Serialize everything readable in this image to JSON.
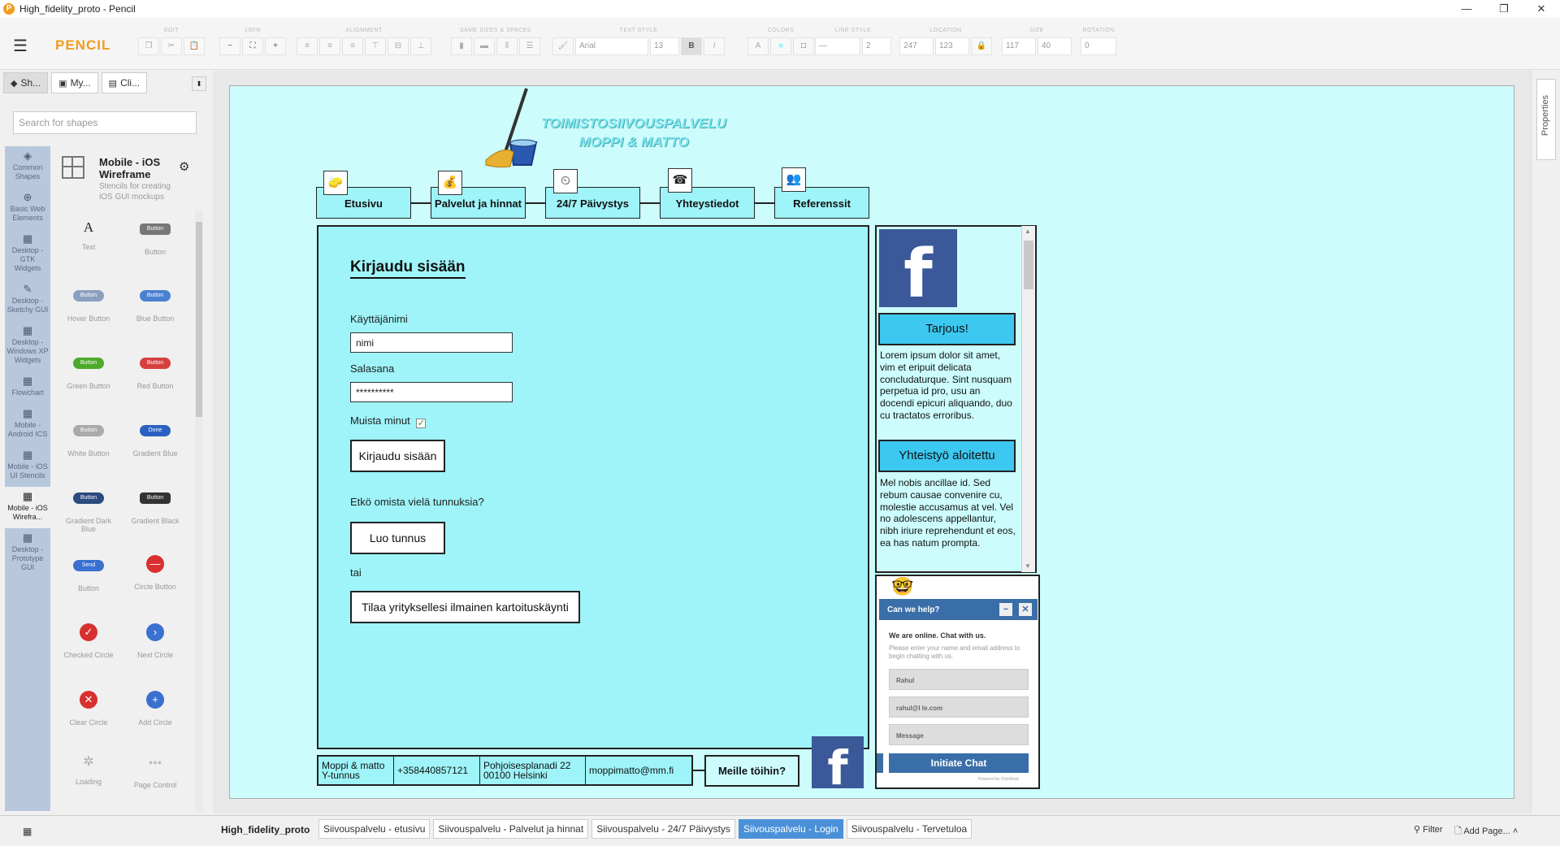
{
  "window": {
    "title": "High_fidelity_proto - Pencil",
    "controls": [
      "—",
      "❐",
      "✕"
    ]
  },
  "toolbar": {
    "brand": "PENCIL",
    "groups": {
      "edit": "EDIT",
      "zoom": "100%",
      "alignment": "ALIGNMENT",
      "same_sizes": "SAME SIZES & SPACES",
      "text_style": "TEXT STYLE",
      "colors": "COLORS",
      "line_style": "LINE STYLE",
      "location": "LOCATION",
      "size": "SIZE",
      "rotation": "ROTATION"
    },
    "font_name": "Arial",
    "font_size": "13",
    "bold": "B",
    "italic": "I",
    "line_width": "2",
    "loc_x": "247",
    "loc_y": "123",
    "size_w": "117",
    "size_h": "40",
    "rotation": "0"
  },
  "left": {
    "tabs": [
      {
        "icon": "stack-icon",
        "label": "Sh..."
      },
      {
        "icon": "briefcase-icon",
        "label": "My..."
      },
      {
        "icon": "image-icon",
        "label": "Cli..."
      }
    ],
    "search_placeholder": "Search for shapes",
    "categories": [
      "Common Shapes",
      "Basic Web Elements",
      "Desktop - GTK Widgets",
      "Desktop - Sketchy GUI",
      "Desktop - Windows XP Widgets",
      "Flowchart",
      "Mobile - Android ICS",
      "Mobile - iOS UI Stencils",
      "Mobile - iOS Wirefra...",
      "Desktop - Prototype GUI"
    ],
    "library": {
      "name": "Mobile - iOS Wireframe",
      "desc": "Stencils for creating iOS GUI mockups"
    },
    "shapes": [
      {
        "label": "Text",
        "preview": "A"
      },
      {
        "label": "Button",
        "preview": "Button"
      },
      {
        "label": "Hover Button",
        "preview": "Button"
      },
      {
        "label": "Blue Button",
        "preview": "Button"
      },
      {
        "label": "Green Button",
        "preview": "Button"
      },
      {
        "label": "Red Button",
        "preview": "Button"
      },
      {
        "label": "White Button",
        "preview": "Button"
      },
      {
        "label": "Gradient Blue",
        "preview": "Done"
      },
      {
        "label": "Gradient Dark Blue",
        "preview": "Button"
      },
      {
        "label": "Gradient Black",
        "preview": "Button"
      },
      {
        "label": "Button",
        "preview": "Send"
      },
      {
        "label": "Circle Button",
        "preview": "—"
      },
      {
        "label": "Checked Circle",
        "preview": "✓"
      },
      {
        "label": "Next Circle",
        "preview": "›"
      },
      {
        "label": "Clear Circle",
        "preview": "✕"
      },
      {
        "label": "Add Circle",
        "preview": "+"
      },
      {
        "label": "Loading",
        "preview": "✲"
      },
      {
        "label": "Page Control",
        "preview": "●●●"
      }
    ]
  },
  "right": {
    "properties": "Properties"
  },
  "mockup": {
    "logo_line1": "TOIMISTOSIIVOUSPALVELU",
    "logo_line2": "MOPPI & MATTO",
    "nav": [
      "Etusivu",
      "Palvelut ja hinnat",
      "24/7 Päivystys",
      "Yhteystiedot",
      "Referenssit"
    ],
    "login": {
      "heading": "Kirjaudu sisään",
      "user_label": "Käyttäjänimi",
      "user_value": "nimi",
      "pass_label": "Salasana",
      "pass_value": "**********",
      "remember": "Muista minut",
      "remember_check": "✓",
      "login_button": "Kirjaudu sisään",
      "no_account": "Etkö omista vielä tunnuksia?",
      "create_button": "Luo tunnus",
      "or": "tai",
      "visit_button": "Tilaa yrityksellesi ilmainen kartoituskäynti"
    },
    "side": {
      "fb": "f",
      "offer_button": "Tarjous!",
      "offer_text": "Lorem ipsum dolor sit amet, vim et eripuit delicata concludaturque. Sint nusquam perpetua id pro, usu an docendi epicuri aliquando, duo cu tractatos erroribus.",
      "coop_button": "Yhteistyö aloitettu",
      "coop_text": "Mel nobis ancillae id. Sed rebum causae convenire cu, molestie accusamus at vel. Vel no adolescens appellantur, nibh iriure reprehendunt et eos, ea has natum prompta."
    },
    "chat": {
      "title": "Can we help?",
      "online": "We are online. Chat with us.",
      "desc": "Please enter your name and email address to begin chatting with us.",
      "name_value": "Rahul",
      "email_value": "rahul@l          le.com",
      "message_value": "Message",
      "button": "Initiate Chat",
      "powered": "Powered by ClickDesk"
    },
    "footer": {
      "company_line1": "Moppi & matto",
      "company_line2": "Y-tunnus",
      "phone": "+358440857121",
      "address_line1": "Pohjoisesplanadi 22",
      "address_line2": "00100 Helsinki",
      "email": "moppimatto@mm.fi",
      "jobs_button": "Meille töihin?"
    }
  },
  "bottom": {
    "project": "High_fidelity_proto",
    "pages": [
      "Siivouspalvelu - etusivu",
      "Siivouspalvelu - Palvelut ja hinnat",
      "Siivouspalvelu - 24/7 Päivystys",
      "Siivouspalvelu - Login",
      "Siivouspalvelu - Tervetuloa"
    ],
    "active_page": 3,
    "filter": "Filter",
    "add_page": "Add Page..."
  }
}
